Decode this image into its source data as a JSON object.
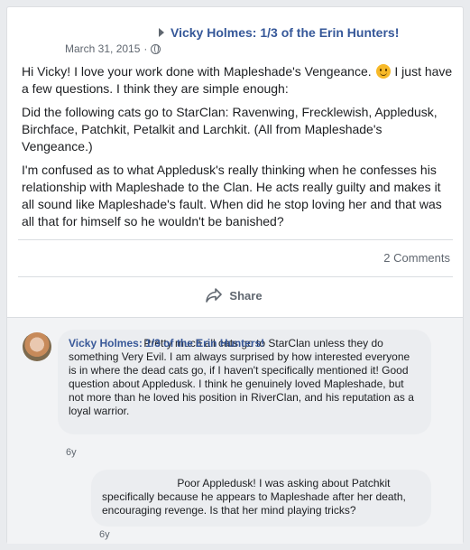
{
  "post": {
    "author": "Vicky Holmes: 1/3 of the Erin Hunters!",
    "date": "March 31, 2015",
    "separator": "·",
    "privacy_icon": "globe-icon",
    "paragraph1_before_emoji": "Hi Vicky! I love your work done with Mapleshade's Vengeance.",
    "emoji": "smiley-icon",
    "paragraph1_after_emoji": "I just have a few questions. I think they are simple enough:",
    "paragraph2": "Did the following cats go to StarClan: Ravenwing, Frecklewish, Appledusk, Birchface, Patchkit, Petalkit and Larchkit. (All from Mapleshade's Vengeance.)",
    "paragraph3": "I'm confused as to what Appledusk's really thinking when he confesses his relationship with Mapleshade to the Clan. He acts really guilty and makes it all sound like Mapleshade's fault. When did he stop loving her and that was all that for himself so he wouldn't be banished?",
    "comment_count": "2 Comments",
    "share_label": "Share"
  },
  "comments": [
    {
      "author": "Vicky Holmes: 1/3 of the Erin Hunters!",
      "text": "                         Pretty much all cats go to StarClan unless they do something Very Evil. I am always surprised by how interested everyone is in where the dead cats go, if I haven't specifically mentioned it! Good question about Appledusk. I think he genuinely loved Mapleshade, but not more than he loved his position in RiverClan, and his reputation as a loyal warrior.",
      "time": "6y"
    },
    {
      "author": "",
      "text": "                         Poor Appledusk! I was asking about Patchkit specifically because he appears to Mapleshade after her death, encouraging revenge. Is that her mind playing tricks?",
      "time": "6y"
    }
  ],
  "colors": {
    "link": "#365899",
    "meta": "#606770",
    "bubble": "#ebedf0",
    "comment_bg": "#f2f3f5"
  }
}
